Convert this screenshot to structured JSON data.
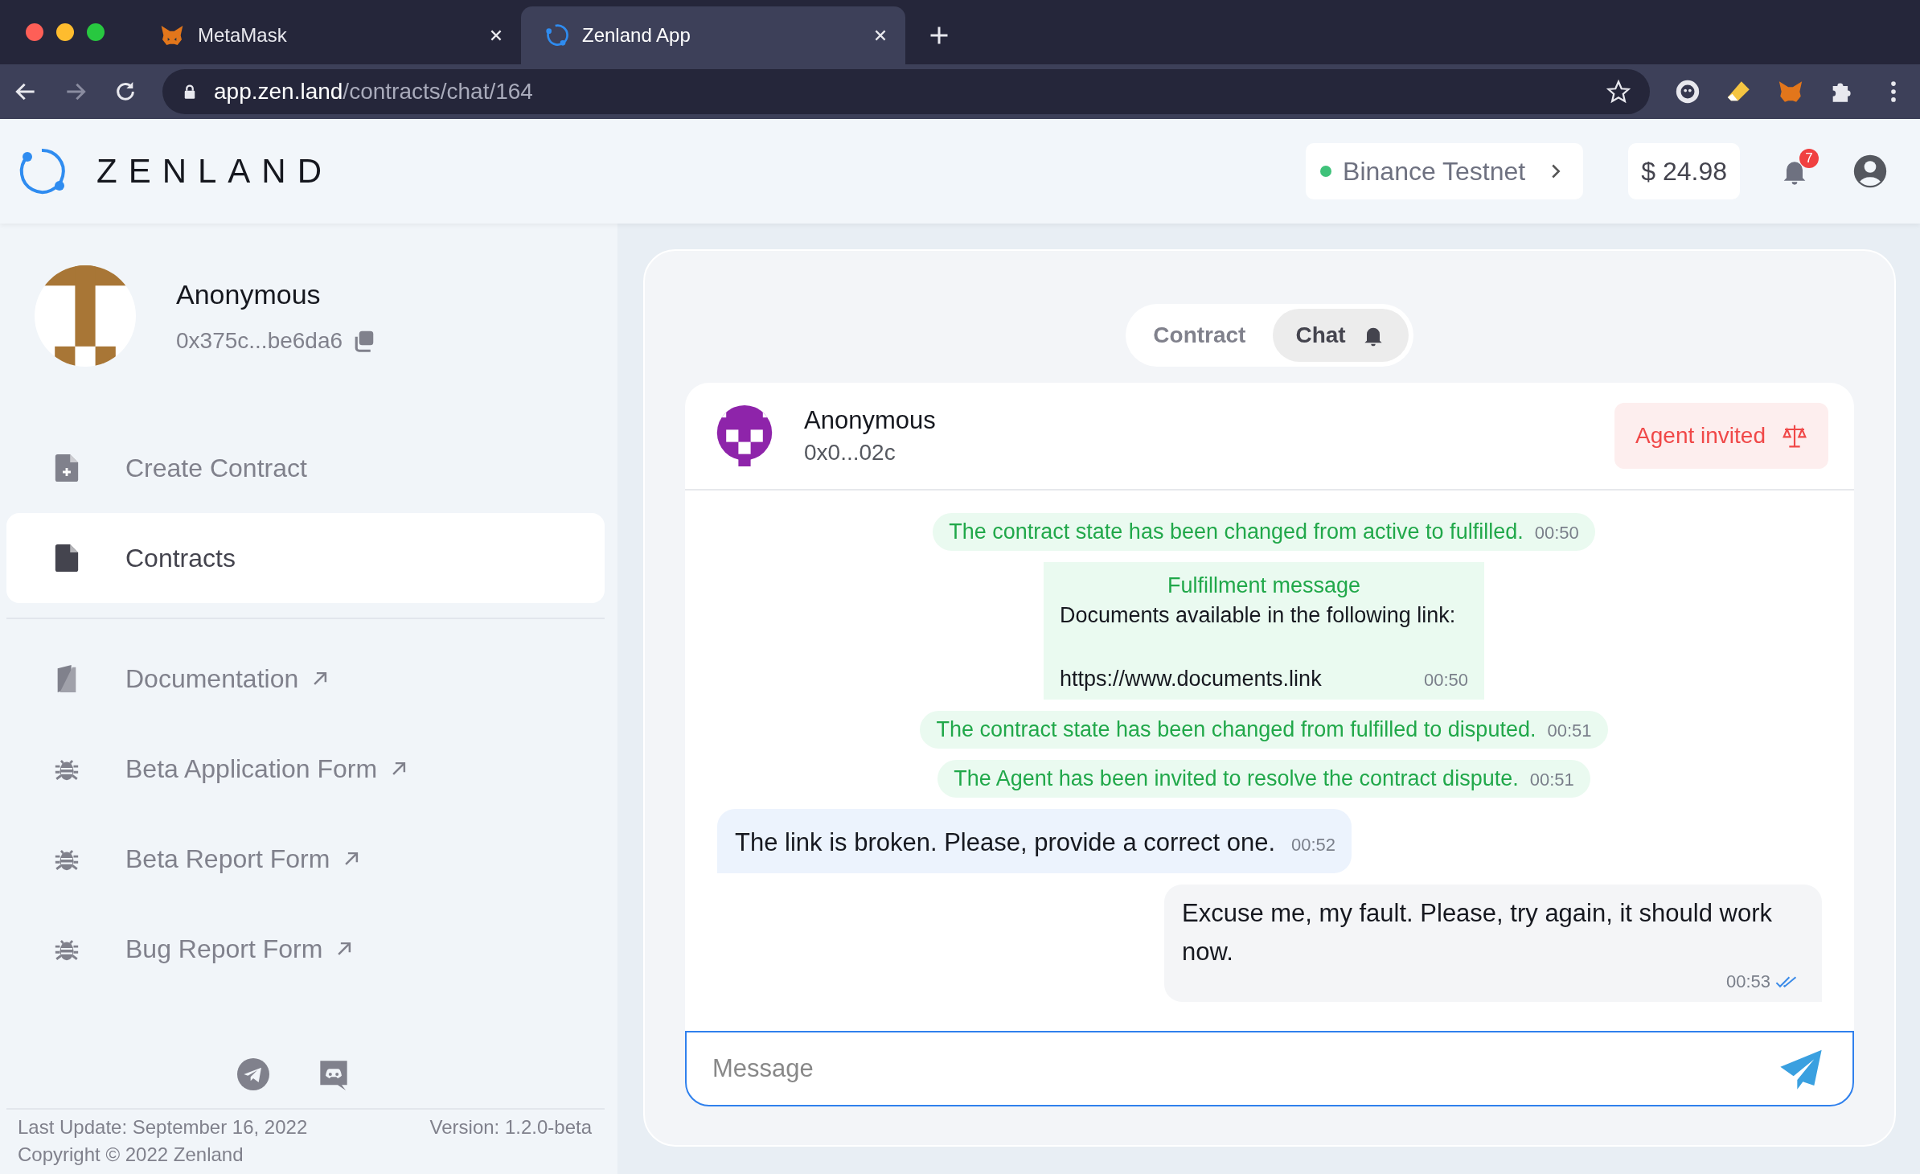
{
  "browser": {
    "tabs": [
      {
        "title": "MetaMask",
        "selected": false
      },
      {
        "title": "Zenland App",
        "selected": true
      }
    ],
    "url": {
      "host": "app.zen.land",
      "path": "/contracts/chat/164"
    }
  },
  "header": {
    "logo_text": "ZENLAND",
    "network": {
      "name": "Binance Testnet",
      "color": "#3fc27a"
    },
    "balance": "$ 24.98",
    "notification_count": "7"
  },
  "sidebar": {
    "profile": {
      "name": "Anonymous",
      "address": "0x375c...be6da6"
    },
    "items": [
      {
        "label": "Create Contract",
        "kind": "internal",
        "selected": false
      },
      {
        "label": "Contracts",
        "kind": "internal",
        "selected": true
      },
      {
        "label": "Documentation",
        "kind": "external",
        "selected": false
      },
      {
        "label": "Beta Application Form",
        "kind": "external",
        "selected": false
      },
      {
        "label": "Beta Report Form",
        "kind": "external",
        "selected": false
      },
      {
        "label": "Bug Report Form",
        "kind": "external",
        "selected": false
      }
    ],
    "footer": {
      "last_update": "Last Update: September 16, 2022",
      "version": "Version: 1.2.0-beta",
      "copyright": "Copyright © 2022 Zenland"
    }
  },
  "main": {
    "view_tabs": [
      {
        "label": "Contract",
        "selected": false
      },
      {
        "label": "Chat",
        "selected": true
      }
    ],
    "chat": {
      "header": {
        "name": "Anonymous",
        "address": "0x0...02c",
        "status": "Agent invited"
      },
      "messages": [
        {
          "kind": "system",
          "text": "The contract state has been changed from active to fulfilled.",
          "time": "00:50"
        },
        {
          "kind": "fulfillment",
          "title": "Fulfillment message",
          "text": "Documents available in the following link:",
          "link": "https://www.documents.link",
          "time": "00:50"
        },
        {
          "kind": "system",
          "text": "The contract state has been changed from fulfilled to disputed.",
          "time": "00:51"
        },
        {
          "kind": "system",
          "text": "The Agent has been invited to resolve the contract dispute.",
          "time": "00:51"
        },
        {
          "kind": "incoming",
          "text": "The link is broken. Please, provide a correct one.",
          "time": "00:52"
        },
        {
          "kind": "outgoing",
          "text": "Excuse me, my fault. Please, try again, it should work now.",
          "time": "00:53",
          "read": true
        }
      ],
      "input": {
        "placeholder": "Message"
      }
    }
  }
}
